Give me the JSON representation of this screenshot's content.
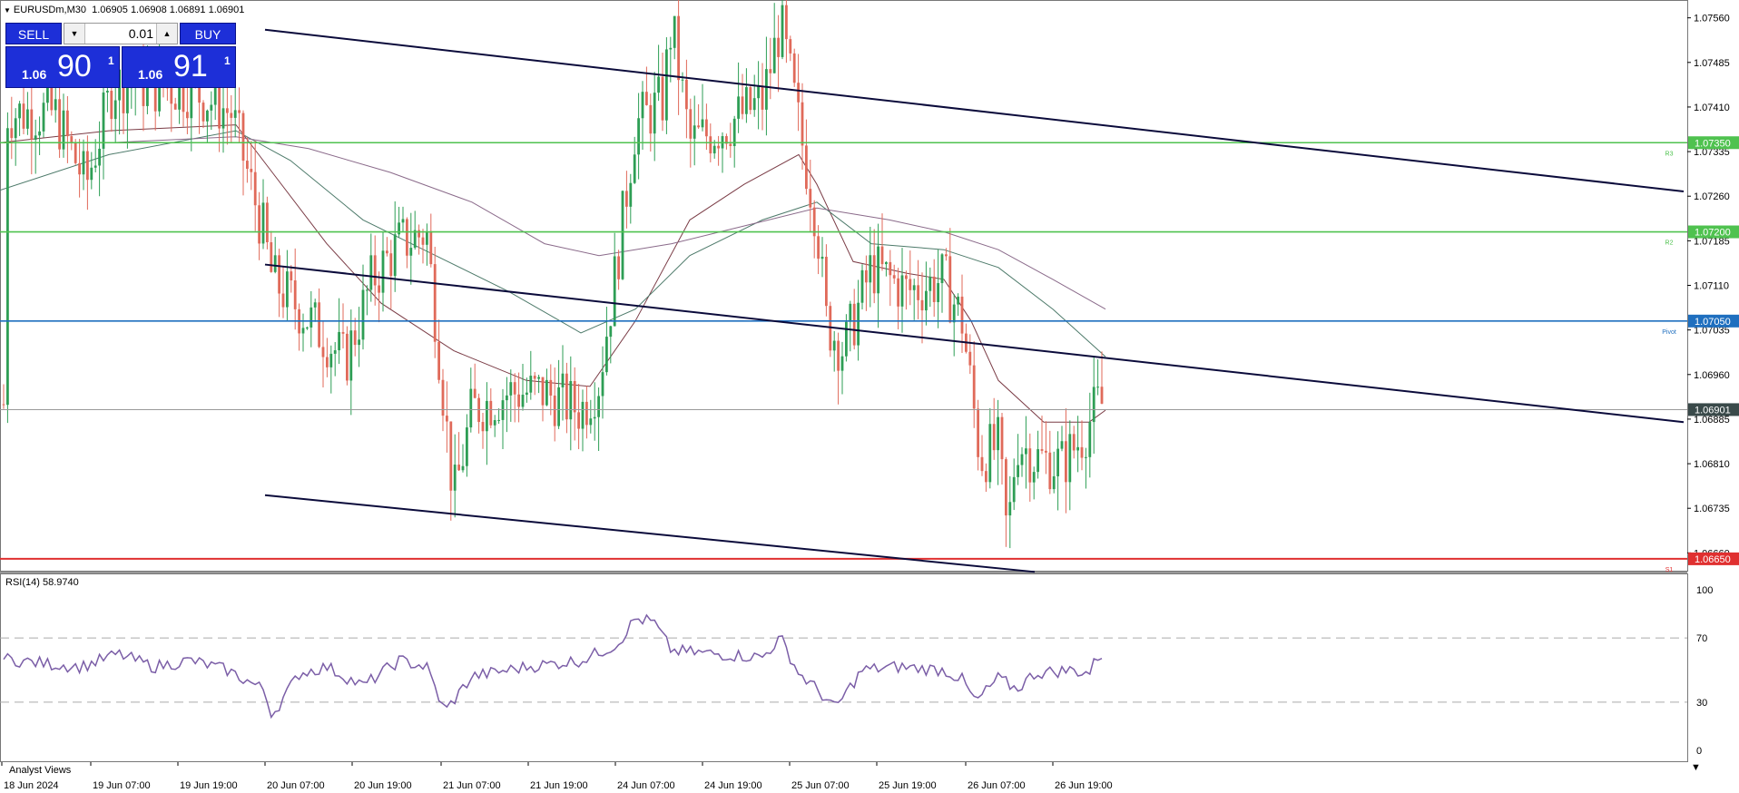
{
  "header": {
    "symbol": "EURUSDm,M30",
    "ohlc": "1.06905 1.06908 1.06891 1.06901"
  },
  "trade_panel": {
    "sell_label": "SELL",
    "buy_label": "BUY",
    "volume": "0.01",
    "bid": {
      "prefix": "1.06",
      "big": "90",
      "sup": "1"
    },
    "ask": {
      "prefix": "1.06",
      "big": "91",
      "sup": "1"
    }
  },
  "price_axis": {
    "ticks": [
      "1.07560",
      "1.07485",
      "1.07410",
      "1.07335",
      "1.07260",
      "1.07185",
      "1.07110",
      "1.07035",
      "1.06960",
      "1.06885",
      "1.06810",
      "1.06735",
      "1.06660"
    ],
    "range": [
      1.0663,
      1.0759
    ]
  },
  "levels": [
    {
      "value": 1.0735,
      "label": "1.07350",
      "tag": "R3",
      "color": "#4fc24f"
    },
    {
      "value": 1.072,
      "label": "1.07200",
      "tag": "R2",
      "color": "#4fc24f"
    },
    {
      "value": 1.0705,
      "label": "1.07050",
      "tag": "Pivot",
      "color": "#1f6fbf"
    },
    {
      "value": 1.0665,
      "label": "1.06650",
      "tag": "S1",
      "color": "#e03030"
    }
  ],
  "current_price": {
    "value": 1.06901,
    "label": "1.06901"
  },
  "time_axis": {
    "labels": [
      "18 Jun 2024",
      "19 Jun 07:00",
      "19 Jun 19:00",
      "20 Jun 07:00",
      "20 Jun 19:00",
      "21 Jun 07:00",
      "21 Jun 19:00",
      "24 Jun 07:00",
      "24 Jun 19:00",
      "25 Jun 07:00",
      "25 Jun 19:00",
      "26 Jun 07:00",
      "26 Jun 19:00"
    ]
  },
  "rsi": {
    "label": "RSI(14) 58.9740",
    "levels": [
      "100",
      "70",
      "30",
      "0"
    ],
    "color": "#7b5ea7"
  },
  "bottom_label": "Analyst Views",
  "colors": {
    "bull": "#2e9e55",
    "bear": "#e06a5a",
    "channel": "#0b0b3b",
    "ma_fast": "#7a3b45",
    "ma_mid": "#4d7a6a",
    "ma_slow": "#8a6a8a"
  },
  "chart_data": {
    "type": "candlestick",
    "title": "EURUSDm,M30",
    "x": [
      "18 Jun 2024",
      "19 Jun 07:00",
      "19 Jun 19:00",
      "20 Jun 07:00",
      "20 Jun 19:00",
      "21 Jun 07:00",
      "21 Jun 19:00",
      "24 Jun 07:00",
      "24 Jun 19:00",
      "25 Jun 07:00",
      "25 Jun 19:00",
      "26 Jun 07:00",
      "26 Jun 19:00"
    ],
    "close_approx": [
      1.0738,
      1.0737,
      1.074,
      1.071,
      1.0712,
      1.069,
      1.0693,
      1.0745,
      1.074,
      1.0702,
      1.0712,
      1.0682,
      1.069
    ],
    "rsi_approx": [
      55,
      58,
      57,
      22,
      52,
      23,
      50,
      80,
      52,
      25,
      52,
      30,
      59
    ],
    "ylim": [
      1.0663,
      1.0759
    ],
    "rsi_ylim": [
      0,
      100
    ]
  }
}
